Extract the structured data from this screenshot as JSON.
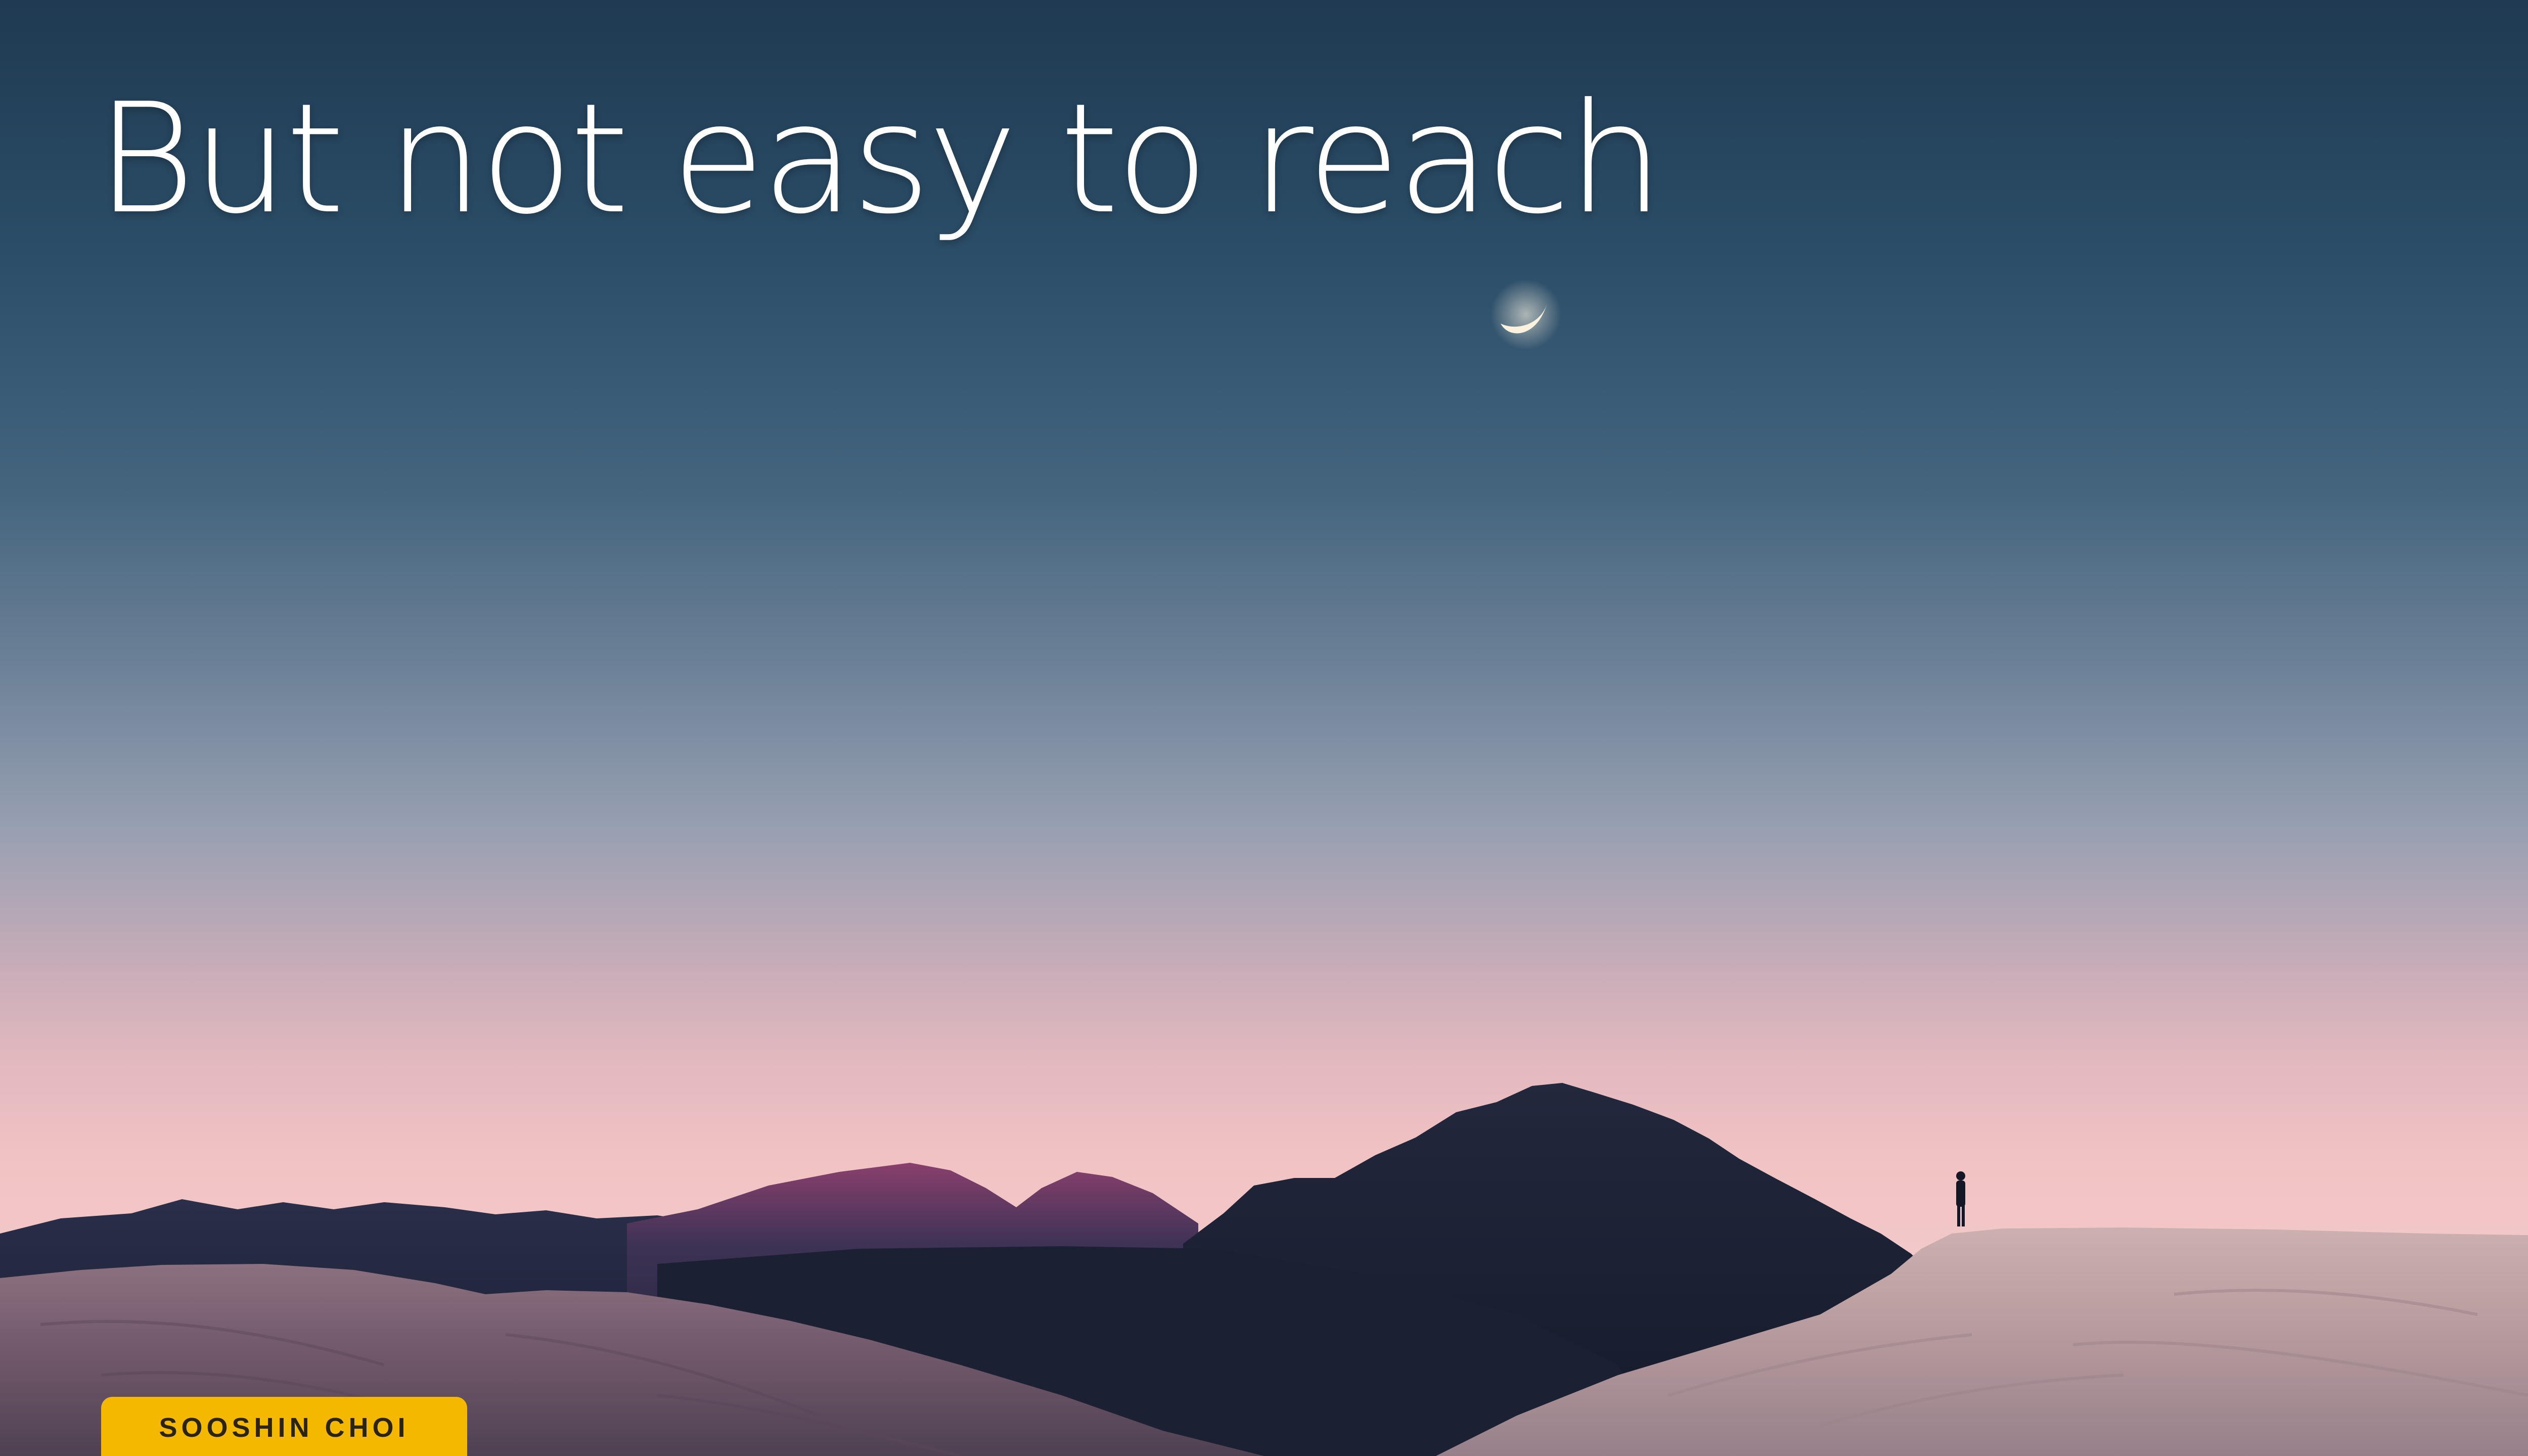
{
  "slide": {
    "title": "But not easy to reach",
    "presenter_tag": "SOOSHIN CHOI"
  },
  "colors": {
    "sky_top": "#1f3a52",
    "sky_horizon": "#f2c8c8",
    "tag_background": "#f5b800",
    "title_text": "#ffffff"
  },
  "elements": {
    "moon": "crescent-moon",
    "figure": "person-silhouette"
  }
}
